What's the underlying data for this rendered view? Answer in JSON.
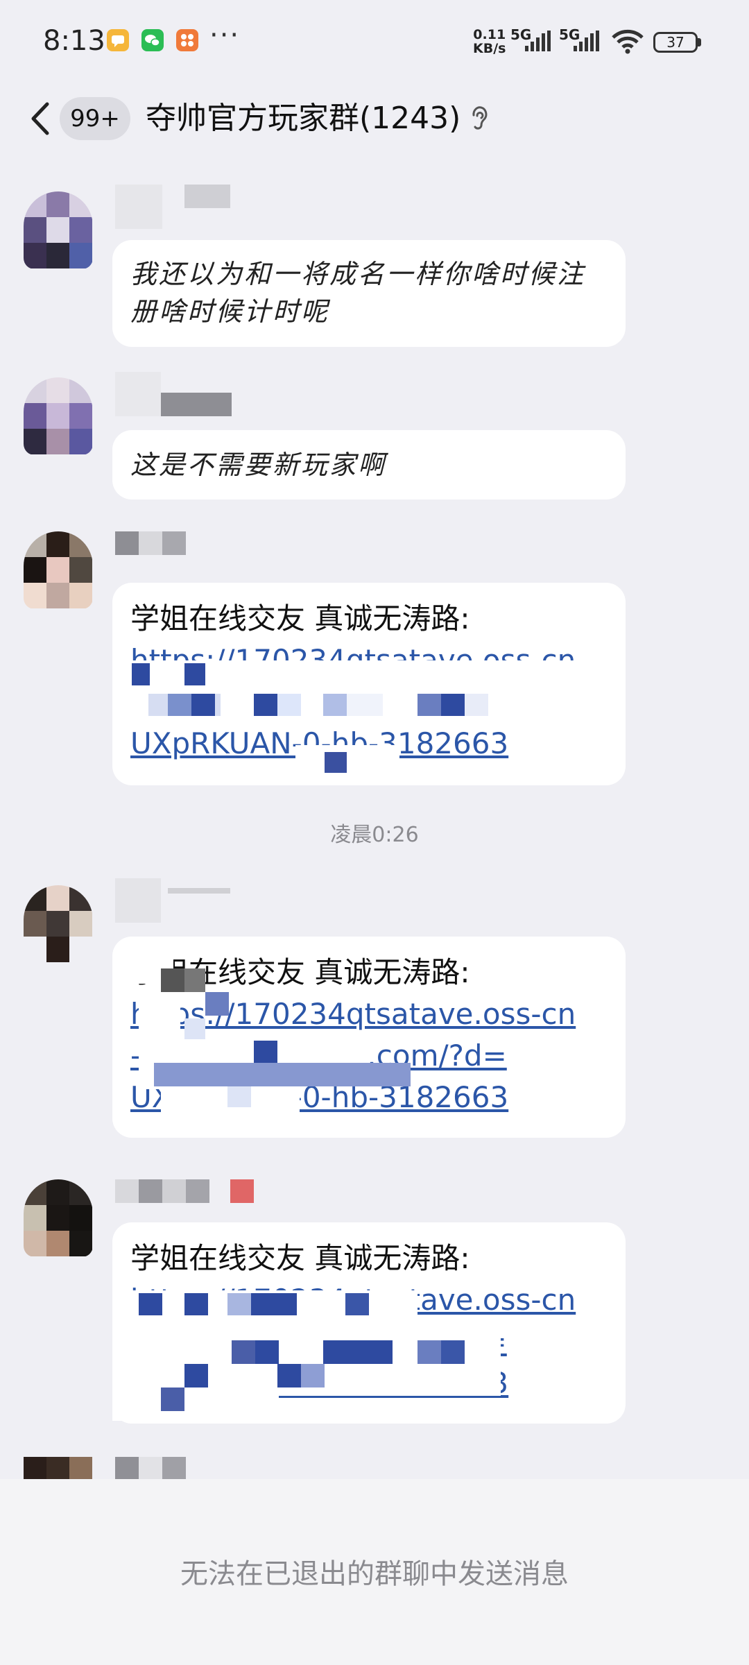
{
  "status_bar": {
    "time": "8:13",
    "more": "···",
    "net_speed": "0.11",
    "net_unit": "KB/s",
    "sim1": "5G",
    "sim2": "5G",
    "battery": "37",
    "icons": [
      "chat-notification-icon",
      "wechat-icon",
      "app-icon",
      "signal-icon",
      "wifi-icon",
      "battery-icon"
    ]
  },
  "header": {
    "unread_count": "99+",
    "title": "夺帅官方玩家群(1243)"
  },
  "messages": [
    {
      "type": "text",
      "text": "我还以为和一将成名一样你啥时候注册啥时候计时呢"
    },
    {
      "type": "text",
      "text": "这是不需要新玩家啊"
    },
    {
      "type": "link",
      "head": "学姐在线交友 真诚无涛路:",
      "line1": "https://170234qtsatave.oss-cn",
      "line3": "UXpRKUAN-0-hb-3182663"
    },
    {
      "type": "link",
      "head": "学姐在线交友 真诚无涛路:",
      "line1": "https://170234qtsatave.oss-cn",
      "line2": "-beijing.aliyuncs.com/?d=",
      "line3": "UXpRKUAN-0-hb-3182663"
    },
    {
      "type": "link",
      "head": "学姐在线交友 真诚无涛路:",
      "line1": "https://170234qtsatave.oss-cn",
      "line2": "-beijing.aliyuncs.com/?d=",
      "line3": "UXpRKUAN-0-hb-3182663"
    }
  ],
  "timestamp": "凌晨0:26",
  "footer": {
    "notice": "无法在已退出的群聊中发送消息"
  },
  "colors": {
    "link": "#2b56a8",
    "background": "#efeff4",
    "bubble": "#ffffff"
  }
}
